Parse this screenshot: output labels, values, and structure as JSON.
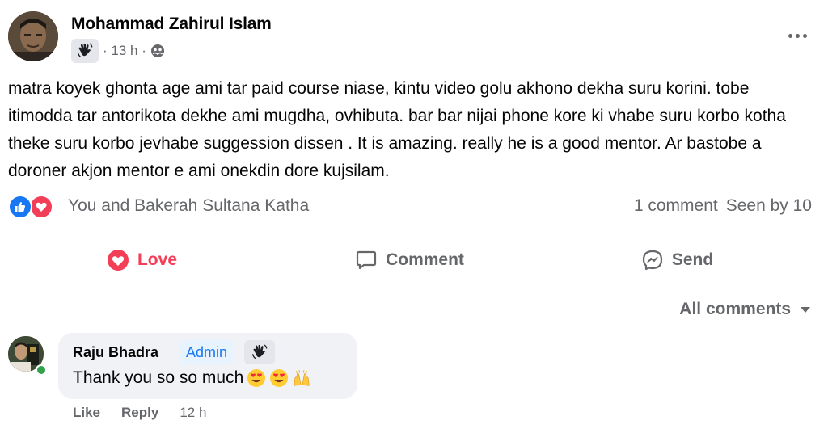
{
  "post": {
    "author": "Mohammad Zahirul Islam",
    "time": "· 13 h ·",
    "body": "matra koyek ghonta age ami tar paid course  niase, kintu video golu akhono dekha suru korini. tobe itimodda tar antorikota dekhe ami mugdha, ovhibuta. bar bar nijai phone kore ki vhabe suru korbo kotha theke suru korbo jevhabe suggession dissen . It is amazing. really he is a good mentor. Ar bastobe a doroner akjon mentor e ami onekdin dore kujsilam.",
    "privacy_icon": "group-icon",
    "badge_icon": "wave-hand-icon"
  },
  "reactions": {
    "names": "You and Bakerah Sultana Katha",
    "comments_count": "1 comment",
    "seen_by": "Seen by 10",
    "types": [
      "like",
      "love"
    ]
  },
  "actions": {
    "love": "Love",
    "comment": "Comment",
    "send": "Send"
  },
  "comments_filter": "All comments",
  "comment": {
    "name": "Raju Bhadra",
    "badge": "Admin",
    "text": "Thank you so so much",
    "emojis": [
      "heart-eyes",
      "heart-eyes",
      "raising-hands"
    ],
    "like": "Like",
    "reply": "Reply",
    "time": "12 h"
  },
  "colors": {
    "brand_blue": "#1877f2",
    "love_red": "#f33e58",
    "secondary_text": "#65676b",
    "bubble_bg": "#f0f2f5",
    "online_green": "#31a24c"
  }
}
